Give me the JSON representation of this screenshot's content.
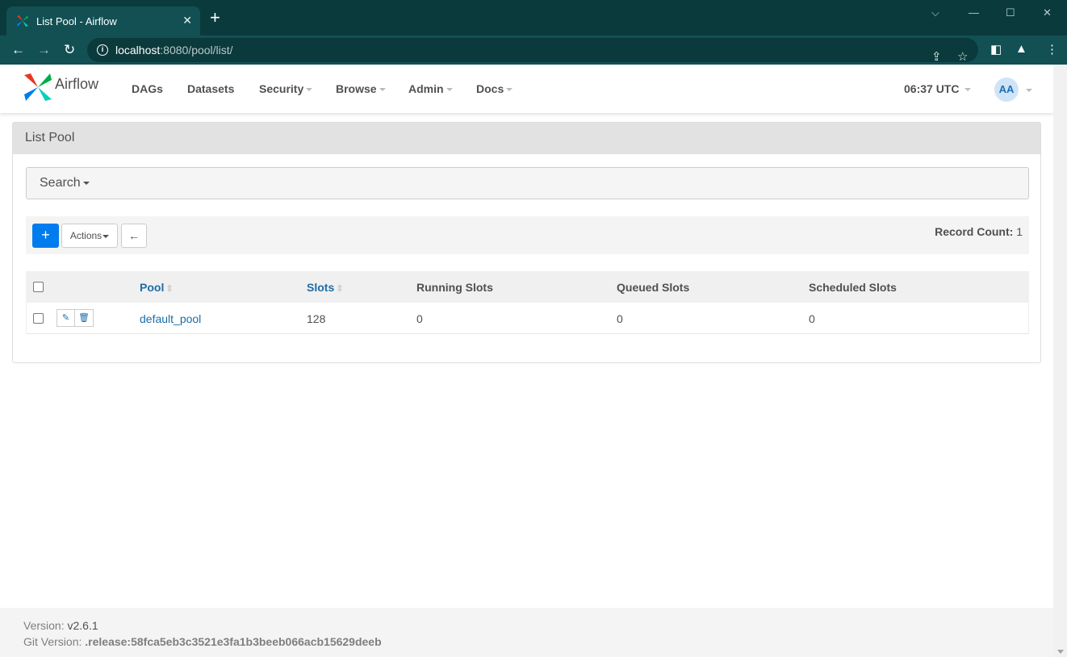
{
  "browser": {
    "tab_title": "List Pool - Airflow",
    "url_host": "localhost",
    "url_rest": ":8080/pool/list/"
  },
  "navbar": {
    "brand": "Airflow",
    "items": [
      "DAGs",
      "Datasets",
      "Security",
      "Browse",
      "Admin",
      "Docs"
    ],
    "clock": "06:37 UTC",
    "avatar_initials": "AA"
  },
  "panel": {
    "title": "List Pool",
    "search_label": "Search",
    "actions_label": "Actions",
    "add_label": "+",
    "record_count_label": "Record Count:",
    "record_count": "1"
  },
  "table": {
    "headers": [
      "Pool",
      "Slots",
      "Running Slots",
      "Queued Slots",
      "Scheduled Slots"
    ],
    "rows": [
      {
        "pool": "default_pool",
        "slots": "128",
        "running": "0",
        "queued": "0",
        "scheduled": "0"
      }
    ]
  },
  "footer": {
    "version_label": "Version:",
    "version": "v2.6.1",
    "git_label": "Git Version:",
    "git_version": ".release:58fca5eb3c3521e3fa1b3beeb066acb15629deeb"
  },
  "colors": {
    "accent": "#017cee",
    "link": "#1c6ca7",
    "chrome": "#0b3a3c"
  }
}
